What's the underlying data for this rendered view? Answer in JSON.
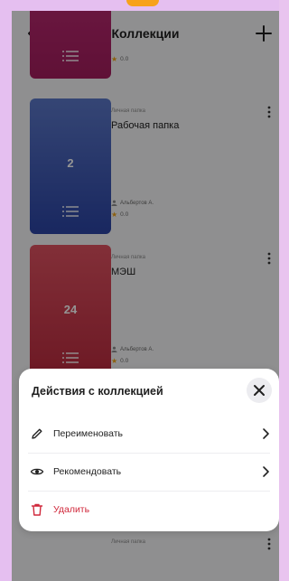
{
  "header": {
    "title": "Коллекции"
  },
  "folders": [
    {
      "kind": "",
      "name": "",
      "count": "",
      "author": "",
      "rating": "0.0",
      "color": "magenta"
    },
    {
      "kind": "Личная папка",
      "name": "Рабочая папка",
      "count": "2",
      "author": "Альбертов А.",
      "rating": "0.0",
      "color": "blue"
    },
    {
      "kind": "Личная папка",
      "name": "МЭШ",
      "count": "24",
      "author": "Альбертов А.",
      "rating": "0.0",
      "color": "red"
    },
    {
      "kind": "Личная папка",
      "name": "",
      "count": "",
      "author": "",
      "rating": "",
      "color": "blue"
    }
  ],
  "sheet": {
    "title": "Действия с коллекцией",
    "actions": [
      {
        "label": "Переименовать",
        "icon": "pencil-icon"
      },
      {
        "label": "Рекомендовать",
        "icon": "eye-icon"
      },
      {
        "label": "Удалить",
        "icon": "trash-icon"
      }
    ]
  },
  "colors": {
    "accent_danger": "#d0283b",
    "star": "#f0a419",
    "blue_cover": "#3a54b3",
    "red_cover": "#c9384c"
  }
}
